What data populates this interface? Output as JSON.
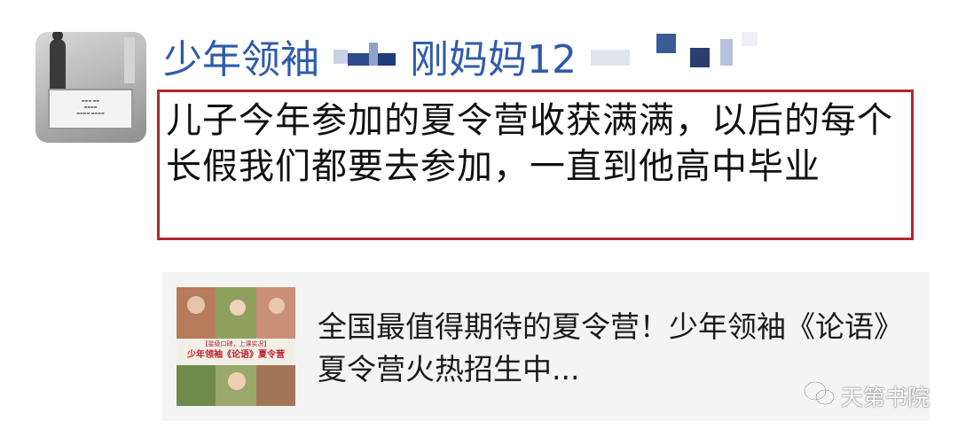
{
  "post": {
    "sender_visible_start": "少年领袖",
    "sender_visible_mid": "刚妈妈12",
    "message": "儿子今年参加的夏令营收获满满，以后的每个长假我们都要去参加，一直到他高中毕业"
  },
  "card": {
    "thumb_line1": "【星级口碑，上课实况】",
    "thumb_line2": "少年领袖《论语》夏令营",
    "title": "全国最值得期待的夏令营！少年领袖《论语》夏令营火热招生中..."
  },
  "watermark": {
    "icon": "wechat-icon",
    "text": "天第书院"
  },
  "colors": {
    "sender": "#2f5bab",
    "highlight_border": "#b3262c",
    "card_bg": "#f4f4f4"
  }
}
